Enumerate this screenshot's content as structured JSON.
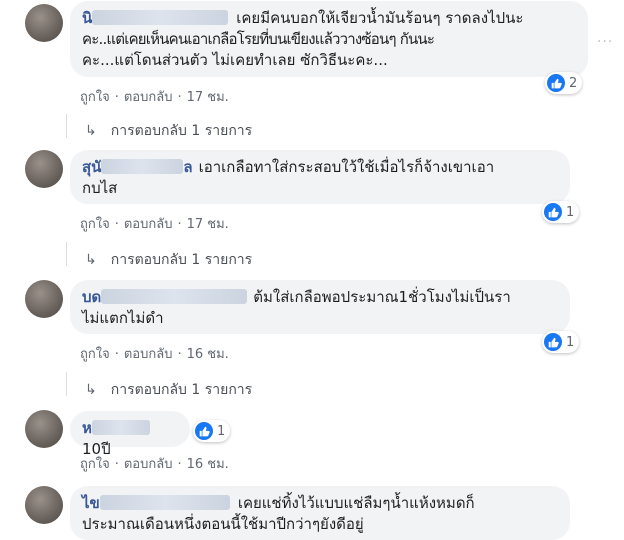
{
  "comments": [
    {
      "name_visible": "นิ",
      "text": "เคยมีคนบอกให้เจียวน้ำมันร้อนๆ ราดลงไปนะคะ..แต่เคยเห็นคนเอาเกลือโรยที่บนเขียงแล้ววางซ้อนๆ กันนะคะ...แต่โดนส่วนตัว ไม่เคยทำเลย ซักวิธีนะคะ...",
      "lines": [
        "เคยมีคนบอกให้เจียวน้ำมันร้อนๆ ราดลงไปนะ",
        "คะ..แต่เคยเห็นคนเอาเกลือโรยที่บนเขียงแล้ววางซ้อนๆ กันนะ",
        "คะ...แต่โดนส่วนตัว ไม่เคยทำเลย ซักวิธีนะคะ..."
      ],
      "reaction_count": "2",
      "like_label": "ถูกใจ",
      "reply_label": "ตอบกลับ",
      "time": "17 ชม.",
      "replies_label": "การตอบกลับ 1 รายการ"
    },
    {
      "name_visible": "สุนั",
      "name_tail": "ล",
      "lines": [
        "เอาเกลือทาใส่กระสอบใว้ใช้เมื่อไรก็จ้างเขาเอา",
        "กบไส"
      ],
      "reaction_count": "1",
      "like_label": "ถูกใจ",
      "reply_label": "ตอบกลับ",
      "time": "17 ชม.",
      "replies_label": "การตอบกลับ 1 รายการ"
    },
    {
      "name_visible": "บด",
      "lines": [
        "ต้มใส่เกลือพอประมาณ1ชั่วโมงไม่เป็นรา",
        "ไม่แตกไม่ดำ"
      ],
      "reaction_count": "1",
      "like_label": "ถูกใจ",
      "reply_label": "ตอบกลับ",
      "time": "16 ชม.",
      "replies_label": "การตอบกลับ 1 รายการ"
    },
    {
      "name_visible": "ห",
      "lines": [
        "10ปี"
      ],
      "reaction_count": "1",
      "like_label": "ถูกใจ",
      "reply_label": "ตอบกลับ",
      "time": "16 ชม."
    },
    {
      "name_visible": "ไข",
      "lines": [
        "เคยแช่ทิ้งไว้แบบแช่ลืมๆน้ำแห้งหมดก็",
        "ประมาณเดือนหนึ่งตอนนี้ใช้มาปีกว่าๆยังดีอยู่"
      ]
    }
  ],
  "more_options": "···",
  "colors": {
    "link": "#385898",
    "bubble": "#f2f3f5",
    "like": "#1877f2",
    "meta": "#606770"
  },
  "icons": {
    "reaction": "like-thumb-icon",
    "reply": "reply-arrow-icon",
    "more": "more-options-icon"
  }
}
